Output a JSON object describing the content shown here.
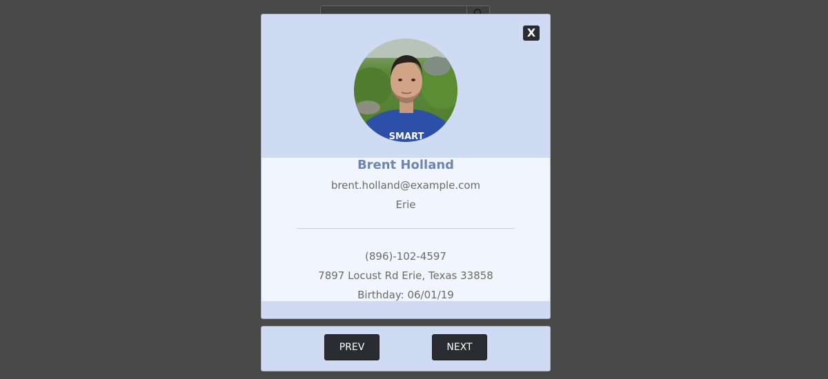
{
  "modal": {
    "close_label": "X",
    "profile": {
      "name": "Brent Holland",
      "email": "brent.holland@example.com",
      "city": "Erie",
      "phone": "(896)-102-4597",
      "address": "7897 Locust Rd Erie, Texas 33858",
      "birthday": "Birthday: 06/01/19"
    }
  },
  "navigation": {
    "prev_label": "PREV",
    "next_label": "NEXT"
  },
  "colors": {
    "backdrop": "#484848",
    "modal_header": "#cedbf3",
    "modal_body": "#f1f5fd",
    "name_accent": "#6c85b4",
    "button_dark": "#2a2c31"
  }
}
